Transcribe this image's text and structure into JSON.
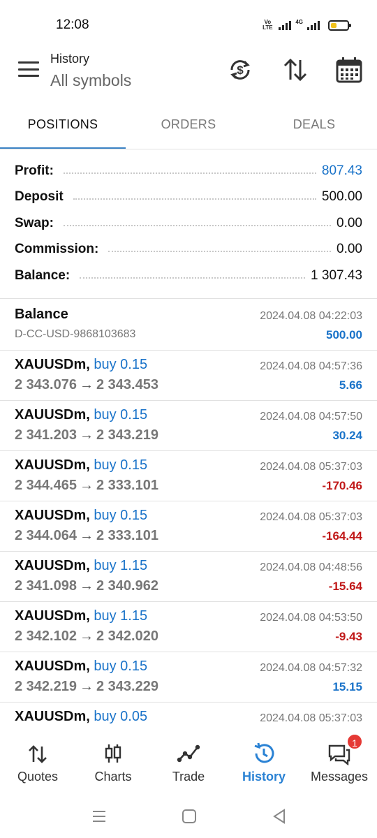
{
  "status_bar": {
    "time": "12:08",
    "volte": "Vo LTE",
    "network": "4G",
    "battery_level": 0.35,
    "battery_color": "#f2c21b"
  },
  "header": {
    "title": "History",
    "subtitle": "All symbols",
    "menu_icon": "hamburger-menu-icon",
    "action_icons": [
      "currency-refresh-icon",
      "sort-icon",
      "calendar-icon"
    ]
  },
  "tabs": [
    {
      "label": "POSITIONS",
      "active": true
    },
    {
      "label": "ORDERS",
      "active": false
    },
    {
      "label": "DEALS",
      "active": false
    }
  ],
  "summary": [
    {
      "label": "Profit:",
      "value": "807.43",
      "color": "#1a73c9"
    },
    {
      "label": "Deposit",
      "value": "500.00"
    },
    {
      "label": "Swap:",
      "value": "0.00"
    },
    {
      "label": "Commission:",
      "value": "0.00"
    },
    {
      "label": "Balance:",
      "value": "1 307.43"
    }
  ],
  "deals": [
    {
      "symbol": "Balance",
      "side": "",
      "line2": "D-CC-USD-9868103683",
      "time": "2024.04.08 04:22:03",
      "profit": "500.00",
      "sign": "pos",
      "type": "balance"
    },
    {
      "symbol": "XAUUSDm,",
      "side": "buy 0.15",
      "open": "2 343.076",
      "close": "2 343.453",
      "time": "2024.04.08 04:57:36",
      "profit": "5.66",
      "sign": "pos",
      "type": "trade"
    },
    {
      "symbol": "XAUUSDm,",
      "side": "buy 0.15",
      "open": "2 341.203",
      "close": "2 343.219",
      "time": "2024.04.08 04:57:50",
      "profit": "30.24",
      "sign": "pos",
      "type": "trade"
    },
    {
      "symbol": "XAUUSDm,",
      "side": "buy 0.15",
      "open": "2 344.465",
      "close": "2 333.101",
      "time": "2024.04.08 05:37:03",
      "profit": "-170.46",
      "sign": "neg",
      "type": "trade"
    },
    {
      "symbol": "XAUUSDm,",
      "side": "buy 0.15",
      "open": "2 344.064",
      "close": "2 333.101",
      "time": "2024.04.08 05:37:03",
      "profit": "-164.44",
      "sign": "neg",
      "type": "trade"
    },
    {
      "symbol": "XAUUSDm,",
      "side": "buy 1.15",
      "open": "2 341.098",
      "close": "2 340.962",
      "time": "2024.04.08 04:48:56",
      "profit": "-15.64",
      "sign": "neg",
      "type": "trade"
    },
    {
      "symbol": "XAUUSDm,",
      "side": "buy 1.15",
      "open": "2 342.102",
      "close": "2 342.020",
      "time": "2024.04.08 04:53:50",
      "profit": "-9.43",
      "sign": "neg",
      "type": "trade"
    },
    {
      "symbol": "XAUUSDm,",
      "side": "buy 0.15",
      "open": "2 342.219",
      "close": "2 343.229",
      "time": "2024.04.08 04:57:32",
      "profit": "15.15",
      "sign": "pos",
      "type": "trade"
    },
    {
      "symbol": "XAUUSDm,",
      "side": "buy 0.05",
      "open": "",
      "close": "",
      "time": "2024.04.08 05:37:03",
      "profit": "",
      "sign": "pos",
      "type": "trade"
    }
  ],
  "arrow": "→",
  "colors": {
    "profit_positive": "#1a73c9",
    "profit_negative": "#c01818",
    "accent": "#3b82c4",
    "badge": "#e53935"
  },
  "bottom_nav": [
    {
      "label": "Quotes",
      "icon": "quotes-arrows-icon",
      "active": false
    },
    {
      "label": "Charts",
      "icon": "candlestick-chart-icon",
      "active": false
    },
    {
      "label": "Trade",
      "icon": "trade-line-icon",
      "active": false
    },
    {
      "label": "History",
      "icon": "history-clock-icon",
      "active": true
    },
    {
      "label": "Messages",
      "icon": "messages-chat-icon",
      "active": false,
      "badge": "1"
    }
  ],
  "system_nav": [
    "recents-icon",
    "home-icon",
    "back-icon"
  ]
}
